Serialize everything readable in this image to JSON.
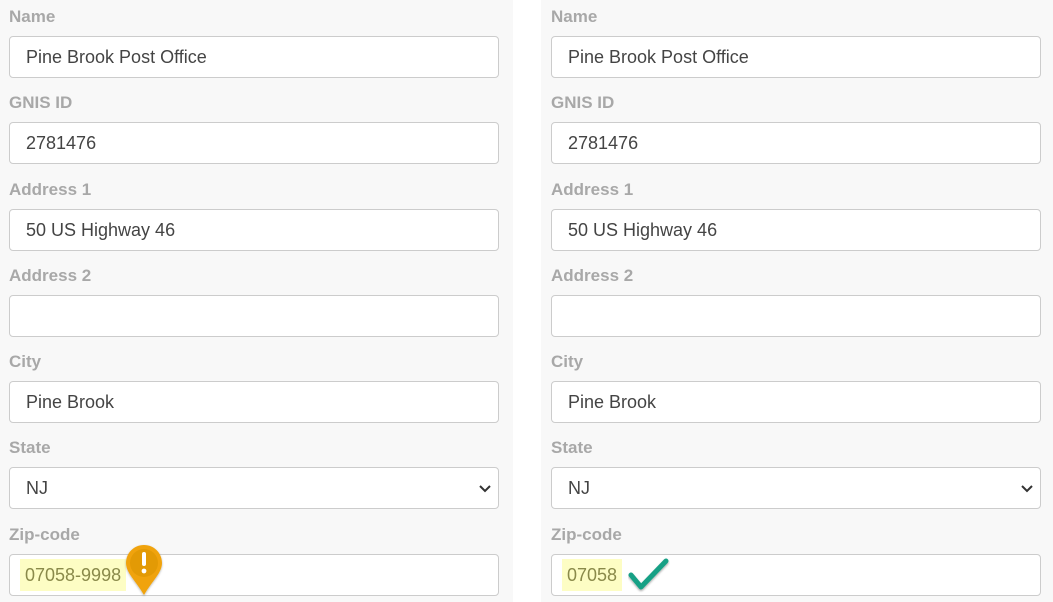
{
  "panels": [
    {
      "fields": [
        {
          "label": "Name",
          "value": "Pine Brook Post Office"
        },
        {
          "label": "GNIS ID",
          "value": "2781476"
        },
        {
          "label": "Address 1",
          "value": "50 US Highway 46"
        },
        {
          "label": "Address 2",
          "value": ""
        },
        {
          "label": "City",
          "value": "Pine Brook"
        },
        {
          "label": "State",
          "value": "NJ"
        },
        {
          "label": "Zip-code",
          "value": "07058-9998"
        }
      ],
      "zip_status": "warning",
      "zip_icon": "warning-pin-icon",
      "zip_icon_glyph": "!",
      "zip_icon_color": "#f0a30a"
    },
    {
      "fields": [
        {
          "label": "Name",
          "value": "Pine Brook Post Office"
        },
        {
          "label": "GNIS ID",
          "value": "2781476"
        },
        {
          "label": "Address 1",
          "value": "50 US Highway 46"
        },
        {
          "label": "Address 2",
          "value": ""
        },
        {
          "label": "City",
          "value": "Pine Brook"
        },
        {
          "label": "State",
          "value": "NJ"
        },
        {
          "label": "Zip-code",
          "value": "07058"
        }
      ],
      "zip_status": "valid",
      "zip_icon": "checkmark-icon",
      "zip_icon_color": "#16a085"
    }
  ],
  "colors": {
    "label": "#a8a8a8",
    "zip_highlight": "#fdfdc4"
  }
}
